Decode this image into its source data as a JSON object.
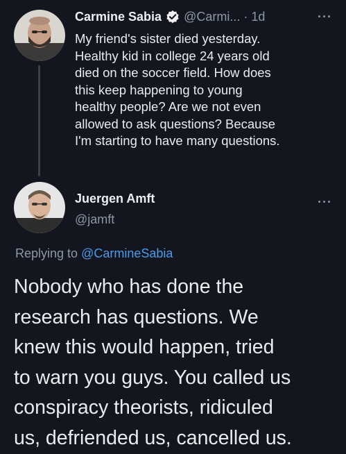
{
  "tweet": {
    "author_name": "Carmine Sabia",
    "handle_truncated": "@Carmi... · 1d",
    "lines": [
      "My friend's sister died yesterday.",
      "Healthy kid in college 24 years old",
      "died on the soccer field. How does",
      "this keep happening to young",
      "healthy people? Are we not even",
      "allowed to ask questions? Because",
      "I'm starting to have many questions."
    ],
    "more_icon": "more-dots-icon"
  },
  "reply": {
    "author_name": "Juergen Amft",
    "handle": "@jamft",
    "replying_prefix": "Replying to ",
    "replying_mention": "@CarmineSabia",
    "lines": [
      "Nobody who has done the",
      "research has questions. We",
      "knew this would happen, tried",
      "to warn you guys. You called us",
      "conspiracy theorists, ridiculed",
      "us, defriended us, cancelled us."
    ],
    "more_icon": "more-dots-icon"
  },
  "colors": {
    "background": "#14161f",
    "text": "#e9ebed",
    "secondary": "#8b98a5",
    "link": "#4a9be8",
    "verified": "#1d9bf0"
  }
}
